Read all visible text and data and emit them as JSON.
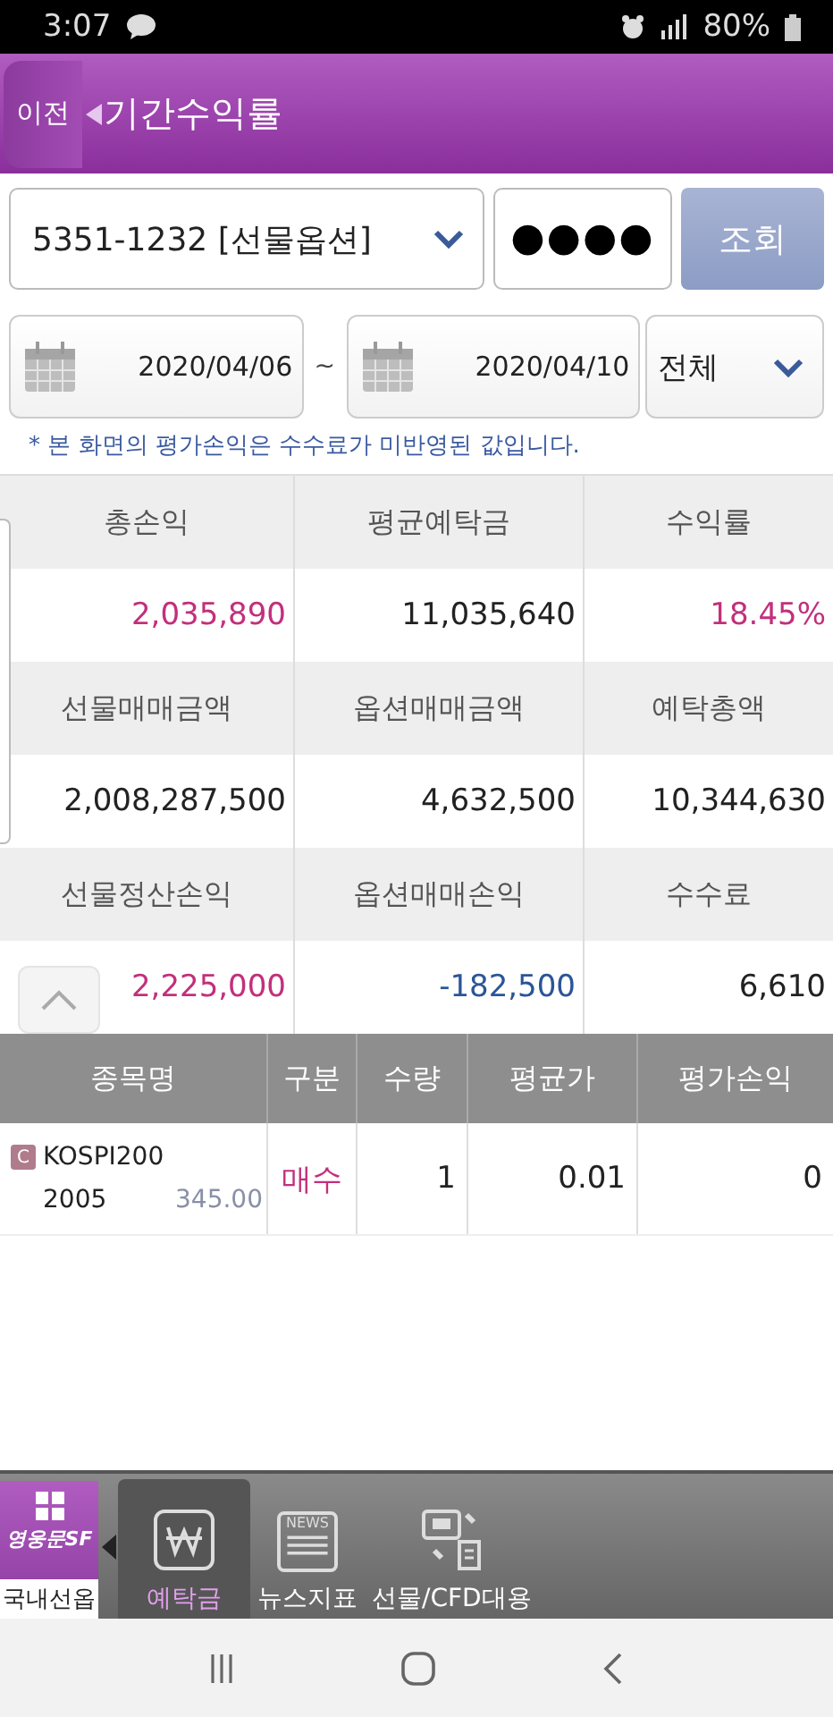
{
  "status_bar": {
    "time": "3:07",
    "battery": "80%"
  },
  "header": {
    "back": "이전",
    "title": "기간수익률"
  },
  "account": {
    "value": "5351-1232 [선물옵션]",
    "password": "●●●●",
    "query_button": "조회"
  },
  "period": {
    "from": "2020/04/06",
    "separator": "~",
    "to": "2020/04/10",
    "filter": "전체"
  },
  "note": "* 본 화면의 평가손익은 수수료가 미반영된 값입니다.",
  "summary": [
    {
      "label": "총손익",
      "value": "2,035,890",
      "color": "#c2307c"
    },
    {
      "label": "평균예탁금",
      "value": "11,035,640",
      "color": "#222222"
    },
    {
      "label": "수익률",
      "value": "18.45%",
      "color": "#c2307c"
    },
    {
      "label": "선물매매금액",
      "value": "2,008,287,500",
      "color": "#222222"
    },
    {
      "label": "옵션매매금액",
      "value": "4,632,500",
      "color": "#222222"
    },
    {
      "label": "예탁총액",
      "value": "10,344,630",
      "color": "#222222"
    },
    {
      "label": "선물정산손익",
      "value": "2,225,000",
      "color": "#c2307c"
    },
    {
      "label": "옵션매매손익",
      "value": "-182,500",
      "color": "#2c5598"
    },
    {
      "label": "수수료",
      "value": "6,610",
      "color": "#222222"
    }
  ],
  "holdings": {
    "columns": [
      "종목명",
      "구분",
      "수량",
      "평균가",
      "평가손익"
    ],
    "rows": [
      {
        "badge": "C",
        "name": "KOSPI200",
        "code": "2005",
        "strike": "345.00",
        "side": {
          "text": "매수",
          "color": "#c2307c"
        },
        "quantity": "1",
        "avg_price": "0.01",
        "pnl": "0"
      }
    ]
  },
  "bottom_nav": {
    "logo": "영웅문SF",
    "logo_caption": "국내선옵",
    "items": [
      {
        "label": "예탁금",
        "kind": "won",
        "selected": true
      },
      {
        "label": "뉴스지표",
        "kind": "news",
        "icon_text": "NEWS",
        "selected": false
      },
      {
        "label": "선물/CFD대용",
        "kind": "transfer",
        "selected": false
      }
    ]
  }
}
